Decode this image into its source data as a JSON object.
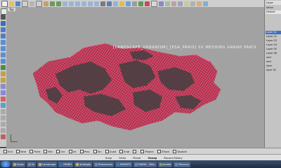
{
  "viewport": {
    "label": "Top",
    "overlay_title": "[LANDSCAPE_URBANISM]_[ESA_PARIS] 02 MESHING GRAND PARIS",
    "mesh_color": "#e0476b",
    "wire_color": "#151515"
  },
  "right_panel": {
    "tab": "Layer",
    "rows": [
      "Name",
      "Default",
      "",
      "Layer 01",
      "Layer 02",
      "Layer 03",
      "Layer 04",
      "Layer 05",
      "Layer 06",
      "sect",
      "sect",
      "layer",
      "layer 02"
    ]
  },
  "snapbar": {
    "items": [
      "End",
      "Near",
      "Point",
      "Mid",
      "Cen",
      "Int",
      "Perp",
      "Tan",
      "Quad",
      "Knot",
      "",
      "Project",
      "STrack",
      "Disable"
    ]
  },
  "statusbar": {
    "items": [
      "Snap",
      "Ortho",
      "Planar",
      "Osnap",
      "Record History"
    ]
  },
  "taskbar": {
    "tasks": [
      {
        "label": "Inbox",
        "color": "#c9a44b"
      },
      {
        "label": "Ss",
        "color": "#8c8c8c"
      },
      {
        "label": "Landscape",
        "color": "#d9b13e"
      },
      {
        "label": "RHINO",
        "color": "#2e6fc2"
      },
      {
        "label": "strategie",
        "color": "#d9b13e"
      },
      {
        "label": "Rhinoceros",
        "color": "#5b8fd6"
      },
      {
        "label": "INFINITY",
        "color": "#3a7bd5"
      },
      {
        "label": "RHINO - Rhin",
        "color": "#5b8fd6"
      },
      {
        "label": "sendel",
        "color": "#7aa84d"
      },
      {
        "label": "Rhinoce",
        "color": "#5b8fd6"
      }
    ]
  }
}
